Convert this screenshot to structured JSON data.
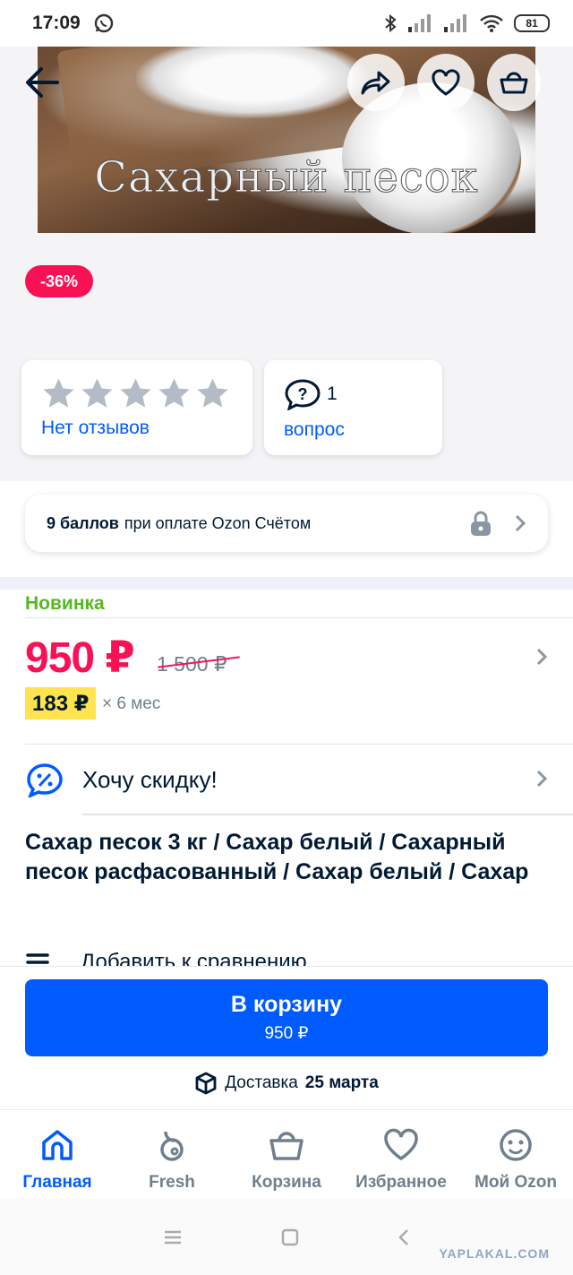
{
  "status_bar": {
    "time": "17:09",
    "battery": "81"
  },
  "hero": {
    "image_text": "Сахарный песок"
  },
  "badge": {
    "discount": "-36%"
  },
  "reviews": {
    "label": "Нет отзывов"
  },
  "questions": {
    "count": "1",
    "label": "вопрос"
  },
  "bonus": {
    "points": "9 баллов",
    "text": "при оплате Ozon Счётом"
  },
  "product": {
    "tag": "Новинка",
    "price": "950 ₽",
    "old_price": "1 500 ₽",
    "installment_amount": "183 ₽",
    "installment_term": "× 6 мес",
    "want_discount": "Хочу скидку!",
    "title": "Сахар песок 3 кг / Сахар белый / Сахарный песок расфасованный / Сахар белый / Сахар",
    "compare": "Добавить к сравнению"
  },
  "cart_button": {
    "label": "В корзину",
    "price": "950 ₽"
  },
  "delivery": {
    "prefix": "Доставка",
    "date": "25 марта"
  },
  "tabbar": [
    {
      "label": "Главная",
      "icon": "home-icon",
      "active": true
    },
    {
      "label": "Fresh",
      "icon": "fresh-icon",
      "active": false
    },
    {
      "label": "Корзина",
      "icon": "basket-icon",
      "active": false
    },
    {
      "label": "Избранное",
      "icon": "heart-icon",
      "active": false
    },
    {
      "label": "Мой Ozon",
      "icon": "profile-icon",
      "active": false
    }
  ],
  "watermark": "YAPLAKAL.COM",
  "colors": {
    "accent": "#005bff",
    "price": "#f91155",
    "new": "#55b81f",
    "installment": "#ffe34f"
  }
}
